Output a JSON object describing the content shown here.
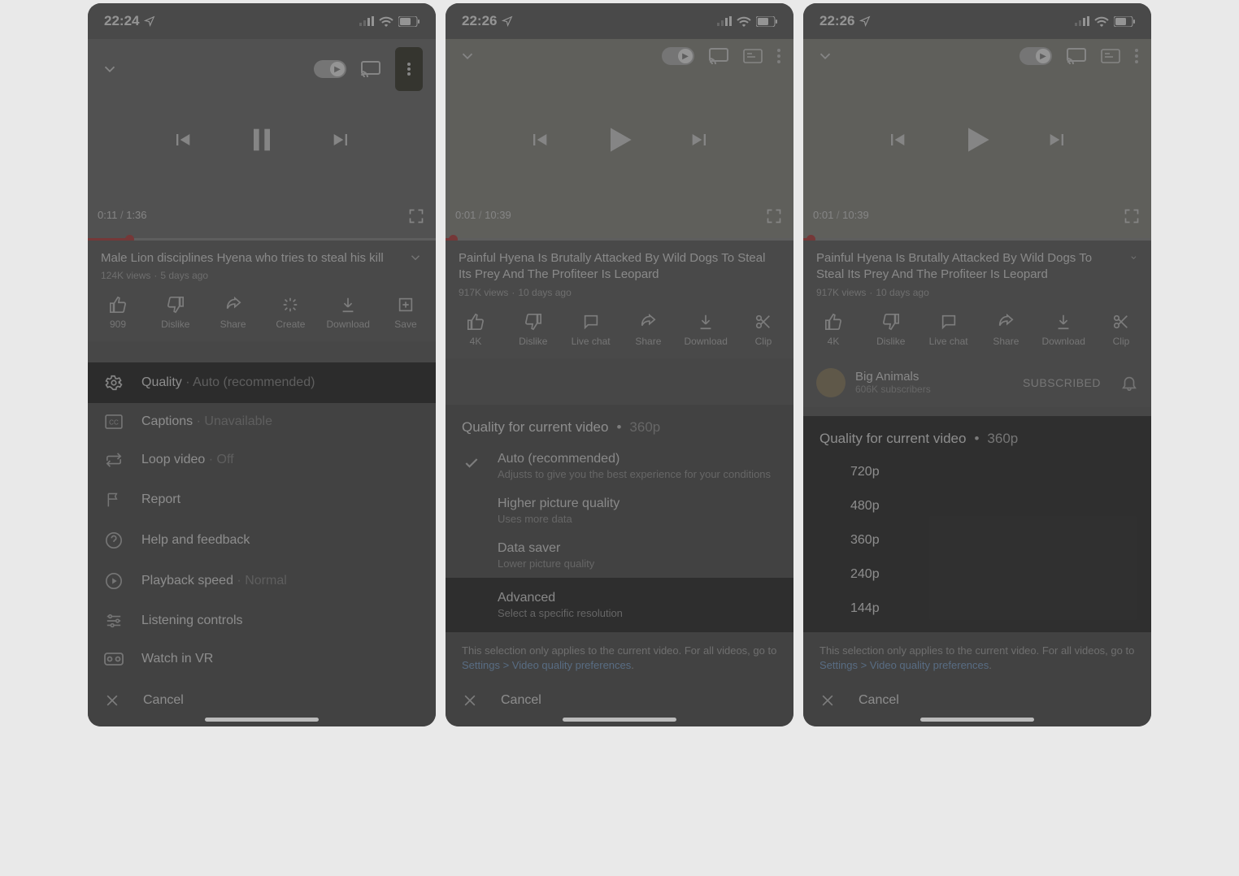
{
  "panel1": {
    "time": "22:24",
    "tc_current": "0:11",
    "tc_total": "1:36",
    "progress_pct": 12,
    "video_title": "Male Lion disciplines Hyena who tries to steal his kill",
    "stats_views": "124K views",
    "stats_age": "5 days ago",
    "actions": {
      "like": "909",
      "dislike": "Dislike",
      "share": "Share",
      "create": "Create",
      "download": "Download",
      "save": "Save"
    },
    "menu": {
      "quality_label": "Quality",
      "quality_value": "Auto (recommended)",
      "captions_label": "Captions",
      "captions_value": "Unavailable",
      "loop_label": "Loop video",
      "loop_value": "Off",
      "report": "Report",
      "help": "Help and feedback",
      "speed_label": "Playback speed",
      "speed_value": "Normal",
      "listening": "Listening controls",
      "vr": "Watch in VR",
      "cancel": "Cancel"
    }
  },
  "panel2": {
    "time": "22:26",
    "tc_current": "0:01",
    "tc_total": "10:39",
    "progress_pct": 2,
    "video_title": "Painful Hyena Is Brutally Attacked By Wild Dogs To Steal Its Prey And The Profiteer Is Leopard",
    "stats_views": "917K views",
    "stats_age": "10 days ago",
    "actions": {
      "like": "4K",
      "dislike": "Dislike",
      "livechat": "Live chat",
      "share": "Share",
      "download": "Download",
      "clip": "Clip"
    },
    "sheet": {
      "header": "Quality for current video",
      "header_val": "360p",
      "auto_title": "Auto (recommended)",
      "auto_desc": "Adjusts to give you the best experience for your conditions",
      "higher_title": "Higher picture quality",
      "higher_desc": "Uses more data",
      "saver_title": "Data saver",
      "saver_desc": "Lower picture quality",
      "adv_title": "Advanced",
      "adv_desc": "Select a specific resolution",
      "note_text": "This selection only applies to the current video. For all videos, go to ",
      "note_link": "Settings > Video quality preferences",
      "cancel": "Cancel"
    }
  },
  "panel3": {
    "time": "22:26",
    "tc_current": "0:01",
    "tc_total": "10:39",
    "progress_pct": 2,
    "video_title": "Painful Hyena Is Brutally Attacked By Wild Dogs To Steal Its Prey And The Profiteer Is Leopard",
    "stats_views": "917K views",
    "stats_age": "10 days ago",
    "actions": {
      "like": "4K",
      "dislike": "Dislike",
      "livechat": "Live chat",
      "share": "Share",
      "download": "Download",
      "clip": "Clip"
    },
    "channel": {
      "name": "Big Animals",
      "subs": "606K subscribers",
      "button": "SUBSCRIBED"
    },
    "sheet": {
      "header": "Quality for current video",
      "header_val": "360p",
      "q1": "720p",
      "q2": "480p",
      "q3": "360p",
      "q4": "240p",
      "q5": "144p",
      "note_text": "This selection only applies to the current video. For all videos, go to ",
      "note_link": "Settings > Video quality preferences",
      "cancel": "Cancel"
    }
  }
}
